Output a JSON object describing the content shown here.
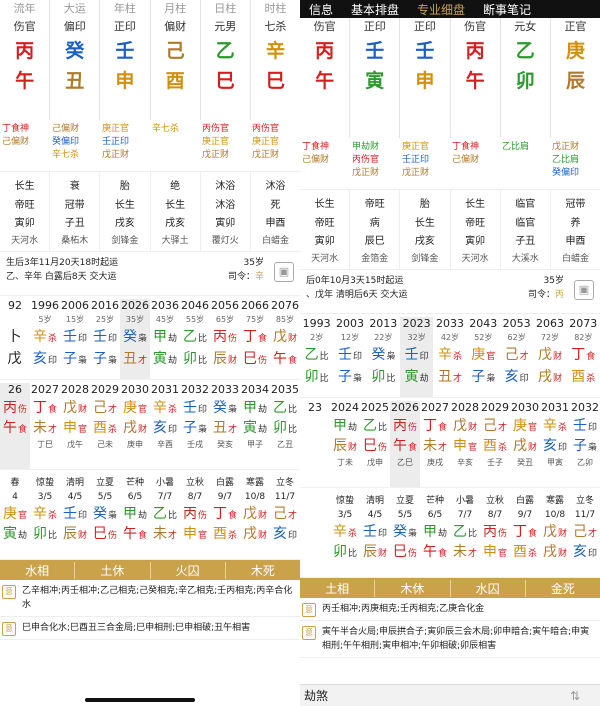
{
  "colors": {
    "fire": "#d51f1f",
    "water": "#1a5fc8",
    "metal": "#d4900c",
    "earth": "#b07a2a",
    "wood": "#2a9a2a",
    "gold": "#c9a24a"
  },
  "left": {
    "headers": [
      "流年",
      "大运",
      "年柱",
      "月柱",
      "日柱",
      "时柱"
    ],
    "gods": [
      "伤官",
      "偏印",
      "正印",
      "偏财",
      "元男",
      "七杀"
    ],
    "stems": [
      {
        "t": "丙",
        "c": "fire"
      },
      {
        "t": "癸",
        "c": "water"
      },
      {
        "t": "壬",
        "c": "water"
      },
      {
        "t": "己",
        "c": "earth"
      },
      {
        "t": "乙",
        "c": "wood"
      },
      {
        "t": "辛",
        "c": "metal"
      }
    ],
    "branches": [
      {
        "t": "午",
        "c": "fire"
      },
      {
        "t": "丑",
        "c": "earth"
      },
      {
        "t": "申",
        "c": "metal"
      },
      {
        "t": "酉",
        "c": "metal"
      },
      {
        "t": "巳",
        "c": "fire"
      },
      {
        "t": "巳",
        "c": "fire"
      }
    ],
    "hidden": [
      [
        "丁食神",
        "己偏财"
      ],
      [
        "己偏财",
        "癸偏印",
        "辛七杀"
      ],
      [
        "庚正官",
        "壬正印",
        "戊正财"
      ],
      [
        "辛七杀"
      ],
      [
        "丙伤官",
        "庚正官",
        "戊正财"
      ],
      [
        "丙伤官",
        "庚正官",
        "戊正财"
      ]
    ],
    "stars": [
      [
        "长生",
        "帝旺",
        "寅卯",
        "天河水"
      ],
      [
        "衰",
        "冠带",
        "子丑",
        "桑柘木"
      ],
      [
        "胎",
        "长生",
        "戌亥",
        "剑锋金"
      ],
      [
        "绝",
        "长生",
        "戌亥",
        "大驿土"
      ],
      [
        "沐浴",
        "沐浴",
        "寅卯",
        "覆灯火"
      ],
      [
        "沐浴",
        "死",
        "申酉",
        "白蜡金"
      ]
    ],
    "info1": "生后3年11月20天18时起运",
    "info2": "乙、辛年 白露后8天 交大运",
    "age": "35岁",
    "ling": "辛",
    "dayun": [
      {
        "y": "92",
        "a": "",
        "s": "卜",
        "ss": "",
        "b": "戊",
        "bs": ""
      },
      {
        "y": "1996",
        "a": "5岁",
        "s": "辛",
        "ss": "杀",
        "b": "亥",
        "bs": "印"
      },
      {
        "y": "2006",
        "a": "15岁",
        "s": "壬",
        "ss": "印",
        "b": "子",
        "bs": "枭"
      },
      {
        "y": "2016",
        "a": "25岁",
        "s": "壬",
        "ss": "印",
        "b": "子",
        "bs": "枭"
      },
      {
        "y": "2026",
        "a": "35岁",
        "s": "癸",
        "ss": "枭",
        "b": "丑",
        "bs": "才",
        "hl": true
      },
      {
        "y": "2036",
        "a": "45岁",
        "s": "甲",
        "ss": "劫",
        "b": "寅",
        "bs": "劫"
      },
      {
        "y": "2046",
        "a": "55岁",
        "s": "乙",
        "ss": "比",
        "b": "卯",
        "bs": "比"
      },
      {
        "y": "2056",
        "a": "65岁",
        "s": "丙",
        "ss": "伤",
        "b": "辰",
        "bs": "财"
      },
      {
        "y": "2066",
        "a": "75岁",
        "s": "丁",
        "ss": "食",
        "b": "巳",
        "bs": "伤"
      },
      {
        "y": "2076",
        "a": "85岁",
        "s": "戊",
        "ss": "财",
        "b": "午",
        "bs": "食"
      }
    ],
    "liunian": [
      {
        "y": "26",
        "s": "丙",
        "ss": "伤",
        "b": "午",
        "bs": "食",
        "sub": "",
        "hl": true
      },
      {
        "y": "2027",
        "s": "丁",
        "ss": "食",
        "b": "未",
        "bs": "才",
        "sub": "丁巳"
      },
      {
        "y": "2028",
        "s": "戊",
        "ss": "财",
        "b": "申",
        "bs": "官",
        "sub": "戊午"
      },
      {
        "y": "2029",
        "s": "己",
        "ss": "才",
        "b": "酉",
        "bs": "杀",
        "sub": "己未"
      },
      {
        "y": "2030",
        "s": "庚",
        "ss": "官",
        "b": "戌",
        "bs": "财",
        "sub": "庚申"
      },
      {
        "y": "2031",
        "s": "辛",
        "ss": "杀",
        "b": "亥",
        "bs": "印",
        "sub": "辛酉"
      },
      {
        "y": "2032",
        "s": "壬",
        "ss": "印",
        "b": "子",
        "bs": "枭",
        "sub": "壬戌"
      },
      {
        "y": "2033",
        "s": "癸",
        "ss": "枭",
        "b": "丑",
        "bs": "才",
        "sub": "癸亥"
      },
      {
        "y": "2034",
        "s": "甲",
        "ss": "劫",
        "b": "寅",
        "bs": "劫",
        "sub": "甲子"
      },
      {
        "y": "2035",
        "s": "乙",
        "ss": "比",
        "b": "卯",
        "bs": "比",
        "sub": "乙丑"
      }
    ],
    "terms": [
      {
        "n": "春",
        "d": "4",
        "s": "庚",
        "ss": "官",
        "b": "寅",
        "bs": "劫"
      },
      {
        "n": "惊蛰",
        "d": "3/5",
        "s": "辛",
        "ss": "杀",
        "b": "卯",
        "bs": "比"
      },
      {
        "n": "清明",
        "d": "4/5",
        "s": "壬",
        "ss": "印",
        "b": "辰",
        "bs": "财"
      },
      {
        "n": "立夏",
        "d": "5/5",
        "s": "癸",
        "ss": "枭",
        "b": "巳",
        "bs": "伤"
      },
      {
        "n": "芒种",
        "d": "6/5",
        "s": "甲",
        "ss": "劫",
        "b": "午",
        "bs": "食"
      },
      {
        "n": "小暑",
        "d": "7/7",
        "s": "乙",
        "ss": "比",
        "b": "未",
        "bs": "才"
      },
      {
        "n": "立秋",
        "d": "8/7",
        "s": "丙",
        "ss": "伤",
        "b": "申",
        "bs": "官"
      },
      {
        "n": "白露",
        "d": "9/7",
        "s": "丁",
        "ss": "食",
        "b": "酉",
        "bs": "杀"
      },
      {
        "n": "寒露",
        "d": "10/8",
        "s": "戊",
        "ss": "财",
        "b": "戌",
        "bs": "财"
      },
      {
        "n": "立冬",
        "d": "11/7",
        "s": "己",
        "ss": "才",
        "b": "亥",
        "bs": "印"
      }
    ],
    "season": [
      "水相",
      "土休",
      "火囚",
      "木死"
    ],
    "notes": [
      "乙辛相冲;丙壬相冲;乙己相克;己癸相克;辛乙相克;壬丙相克;丙辛合化水",
      "巳申合化水;巳酉丑三合金局;巳申相刑;巳申相破;丑午相害"
    ]
  },
  "right": {
    "nav": [
      "信息",
      "基本排盘",
      "专业细盘",
      "断事笔记"
    ],
    "gods": [
      "伤官",
      "正印",
      "正印",
      "伤官",
      "元女",
      "正官"
    ],
    "stems": [
      {
        "t": "丙",
        "c": "fire"
      },
      {
        "t": "壬",
        "c": "water"
      },
      {
        "t": "壬",
        "c": "water"
      },
      {
        "t": "丙",
        "c": "fire"
      },
      {
        "t": "乙",
        "c": "wood"
      },
      {
        "t": "庚",
        "c": "metal"
      }
    ],
    "branches": [
      {
        "t": "午",
        "c": "fire"
      },
      {
        "t": "寅",
        "c": "wood"
      },
      {
        "t": "申",
        "c": "metal"
      },
      {
        "t": "午",
        "c": "fire"
      },
      {
        "t": "卯",
        "c": "wood"
      },
      {
        "t": "辰",
        "c": "earth"
      }
    ],
    "hidden": [
      [
        "丁食神",
        "己偏财"
      ],
      [
        "甲劫财",
        "丙伤官",
        "戊正财"
      ],
      [
        "庚正官",
        "壬正印",
        "戊正财"
      ],
      [
        "丁食神",
        "己偏财"
      ],
      [
        "乙比肩"
      ],
      [
        "戊正财",
        "乙比肩",
        "癸偏印"
      ]
    ],
    "stars": [
      [
        "长生",
        "帝旺",
        "寅卯",
        "天河水"
      ],
      [
        "帝旺",
        "病",
        "辰巳",
        "金箔金"
      ],
      [
        "胎",
        "长生",
        "戌亥",
        "剑锋金"
      ],
      [
        "长生",
        "帝旺",
        "寅卯",
        "天河水"
      ],
      [
        "临官",
        "临官",
        "子丑",
        "大溪水"
      ],
      [
        "冠带",
        "养",
        "申酉",
        "白蜡金"
      ]
    ],
    "info1": "后0年10月3天15时起运",
    "info2": "、戊年 清明后6天 交大运",
    "age": "35岁",
    "ling": "丙",
    "dayun": [
      {
        "y": "1993",
        "a": "2岁",
        "s": "乙",
        "ss": "比",
        "b": "卯",
        "bs": "比"
      },
      {
        "y": "2003",
        "a": "12岁",
        "s": "壬",
        "ss": "印",
        "b": "子",
        "bs": "枭"
      },
      {
        "y": "2013",
        "a": "22岁",
        "s": "癸",
        "ss": "枭",
        "b": "卯",
        "bs": "比"
      },
      {
        "y": "2023",
        "a": "32岁",
        "s": "壬",
        "ss": "印",
        "b": "寅",
        "bs": "劫",
        "hl": true
      },
      {
        "y": "2033",
        "a": "42岁",
        "s": "辛",
        "ss": "杀",
        "b": "丑",
        "bs": "才"
      },
      {
        "y": "2043",
        "a": "52岁",
        "s": "庚",
        "ss": "官",
        "b": "子",
        "bs": "枭"
      },
      {
        "y": "2053",
        "a": "62岁",
        "s": "己",
        "ss": "才",
        "b": "亥",
        "bs": "印"
      },
      {
        "y": "2063",
        "a": "72岁",
        "s": "戊",
        "ss": "财",
        "b": "戌",
        "bs": "财"
      },
      {
        "y": "2073",
        "a": "82岁",
        "s": "丁",
        "ss": "食",
        "b": "酉",
        "bs": "杀"
      }
    ],
    "liunian": [
      {
        "y": "23",
        "s": "",
        "ss": "",
        "b": "",
        "bs": "",
        "sub": ""
      },
      {
        "y": "2024",
        "s": "甲",
        "ss": "劫",
        "b": "辰",
        "bs": "财",
        "sub": "丁未"
      },
      {
        "y": "2025",
        "s": "乙",
        "ss": "比",
        "b": "巳",
        "bs": "伤",
        "sub": "戊申"
      },
      {
        "y": "2026",
        "s": "丙",
        "ss": "伤",
        "b": "午",
        "bs": "食",
        "sub": "乙巳",
        "hl": true
      },
      {
        "y": "2027",
        "s": "丁",
        "ss": "食",
        "b": "未",
        "bs": "才",
        "sub": "庚戌"
      },
      {
        "y": "2028",
        "s": "戊",
        "ss": "财",
        "b": "申",
        "bs": "官",
        "sub": "辛亥"
      },
      {
        "y": "2029",
        "s": "己",
        "ss": "才",
        "b": "酉",
        "bs": "杀",
        "sub": "壬子"
      },
      {
        "y": "2030",
        "s": "庚",
        "ss": "官",
        "b": "戌",
        "bs": "财",
        "sub": "癸丑"
      },
      {
        "y": "2031",
        "s": "辛",
        "ss": "杀",
        "b": "亥",
        "bs": "印",
        "sub": "甲寅"
      },
      {
        "y": "2032",
        "s": "壬",
        "ss": "印",
        "b": "子",
        "bs": "枭",
        "sub": "乙卯"
      }
    ],
    "terms": [
      {
        "n": "",
        "d": "",
        "s": "",
        "ss": "",
        "b": "",
        "bs": ""
      },
      {
        "n": "惊蛰",
        "d": "3/5",
        "s": "辛",
        "ss": "杀",
        "b": "卯",
        "bs": "比"
      },
      {
        "n": "清明",
        "d": "4/5",
        "s": "壬",
        "ss": "印",
        "b": "辰",
        "bs": "财"
      },
      {
        "n": "立夏",
        "d": "5/5",
        "s": "癸",
        "ss": "枭",
        "b": "巳",
        "bs": "伤"
      },
      {
        "n": "芒种",
        "d": "6/5",
        "s": "甲",
        "ss": "劫",
        "b": "午",
        "bs": "食"
      },
      {
        "n": "小暑",
        "d": "7/7",
        "s": "乙",
        "ss": "比",
        "b": "未",
        "bs": "才"
      },
      {
        "n": "立秋",
        "d": "8/7",
        "s": "丙",
        "ss": "伤",
        "b": "申",
        "bs": "官"
      },
      {
        "n": "白露",
        "d": "9/7",
        "s": "丁",
        "ss": "食",
        "b": "酉",
        "bs": "杀"
      },
      {
        "n": "寒露",
        "d": "10/8",
        "s": "戊",
        "ss": "财",
        "b": "戌",
        "bs": "财"
      },
      {
        "n": "立冬",
        "d": "11/7",
        "s": "己",
        "ss": "才",
        "b": "亥",
        "bs": "印"
      }
    ],
    "season": [
      "土相",
      "木休",
      "水囚",
      "金死"
    ],
    "notes": [
      "丙壬相冲;丙庚相克;壬丙相克;乙庚合化金",
      "寅午半合火局;申辰拱合子;寅卯辰三会木局;卯申暗合;寅午暗合;申寅相刑;午午相刑;寅申相冲;午卯相破;卯辰相害"
    ],
    "bottom": "劫煞",
    "bottom_right": "⇅"
  }
}
